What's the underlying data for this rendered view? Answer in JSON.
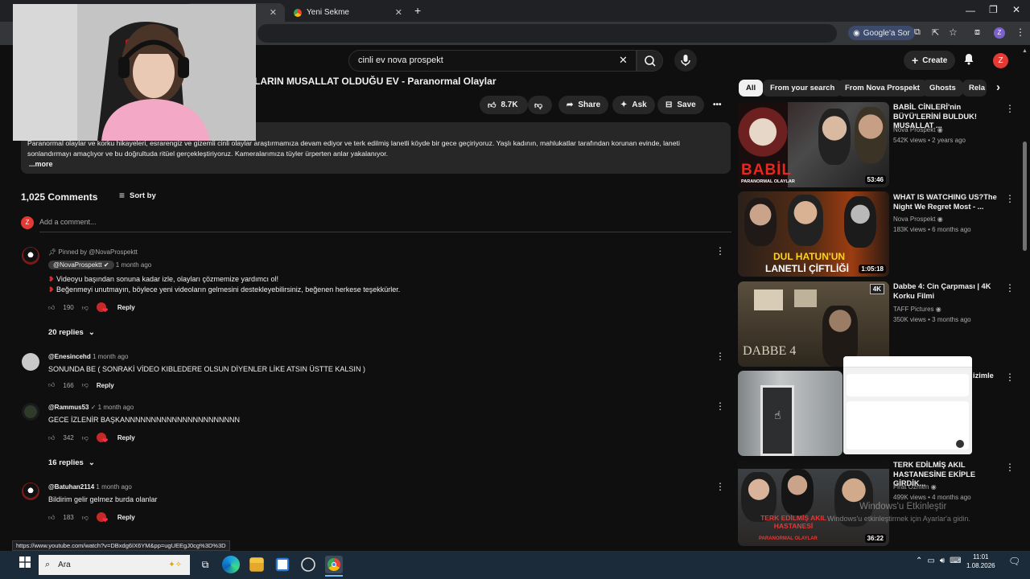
{
  "browser": {
    "tabs": [
      {
        "title": ""
      },
      {
        "title": "Yeni Sekme"
      }
    ],
    "new_tab": "+",
    "google_sor": "Google'a Sor",
    "profile_initial": "Z",
    "status_url": "https://www.youtube.com/watch?v=DBxdg6IX6YM&pp=ugUEEgJ0cg%3D%3D"
  },
  "youtube": {
    "search_value": "cinli ev nova prospekt",
    "create_label": "Create",
    "avatar_initial": "Z",
    "video_title": "LARIN MUSALLAT OLDUĞU EV - Paranormal Olaylar",
    "actions": {
      "likes": "8.7K",
      "share": "Share",
      "ask": "Ask",
      "save": "Save"
    },
    "description_line1": "Paranormal olaylar ve korku hikayeleri, esrarengiz ve gizemli cinli olaylar araştırmamıza devam ediyor ve terk edilmiş lanetli köyde bir gece geçiriyoruz. Yaşlı kadının, mahlukatlar tarafından korunan evinde, laneti",
    "description_line2": "sonlandırmayı amaçlıyor ve bu doğrultuda ritüel gerçekleştiriyoruz. Kameralarımıza tüyler ürperten anlar yakalanıyor.",
    "description_more": "...more",
    "comment_count": "1,025 Comments",
    "sort_by": "Sort by",
    "add_comment": "Add a comment...",
    "self_initial": "Z",
    "comments": [
      {
        "pinned": "Pinned by @NovaProspektt",
        "author": "@NovaProspektt",
        "time": "1 month ago",
        "line1": "Videoyu başından sonuna kadar izle, olayları çözmemize yardımcı ol!",
        "line2": "Beğenmeyi unutmayın, böylece yeni videoların gelmesini destekleyebilirsiniz, beğenen herkese teşekkürler.",
        "likes": "190",
        "reply": "Reply",
        "replies": "20 replies"
      },
      {
        "author": "@Enesincehd",
        "time": "1 month ago",
        "line1": "SONUNDA BE ( SONRAKİ VİDEO KIBLEDERE OLSUN DİYENLER LİKE ATSIN ÜSTTE KALSIN )",
        "likes": "166",
        "reply": "Reply"
      },
      {
        "author": "@Rammus53",
        "time": "1 month ago",
        "line1": "GECE İZLENİR BAŞKANNNNNNNNNNNNNNNNNNNNNN",
        "likes": "342",
        "reply": "Reply",
        "replies": "16 replies"
      },
      {
        "author": "@Batuhan2114",
        "time": "1 month ago",
        "line1": "Bildirim gelir gelmez burda olanlar",
        "likes": "183",
        "reply": "Reply"
      }
    ],
    "chips": [
      "All",
      "From your search",
      "From Nova Prospekt",
      "Ghosts",
      "Rela"
    ],
    "recommendations": [
      {
        "title": "BABİL CİNLERİ'nin BÜYÜ'LERİNİ BULDUK! MUSALLAT ...",
        "channel": "Nova Prospekt",
        "meta": "542K views • 2 years ago",
        "duration": "53:46",
        "thumb_text": "BABİL",
        "thumb_sub": "PARANORMAL OLAYLAR",
        "color": "#3a2a2a"
      },
      {
        "title": "WHAT IS WATCHING US?The Night We Regret Most - ...",
        "channel": "Nova Prospekt",
        "meta": "183K views • 6 months ago",
        "duration": "1:05:18",
        "thumb_text": "DUL HATUN'UN",
        "thumb_sub": "LANETLİ ÇİFTLİĞİ",
        "color": "#2b1e16"
      },
      {
        "title": "Dabbe 4: Cin Çarpması | 4K Korku Filmi",
        "channel": "TAFF Pictures",
        "meta": "350K views • 3 months ago",
        "duration": "",
        "thumb_text": "DABBE 4",
        "thumb_sub": "",
        "badge": "4K",
        "color": "#3d3528"
      },
      {
        "title": "izimle",
        "channel": "",
        "meta": "",
        "duration": "",
        "thumb_text": "",
        "thumb_sub": "",
        "color": "#9fa3a6"
      },
      {
        "title": "TERK EDİLMİŞ AKIL HASTANESİNE EKİPLE GİRDİK...",
        "channel": "Fırat Özmen",
        "meta": "499K views • 4 months ago",
        "duration": "36:22",
        "thumb_text": "TERK EDİLMİŞ AKIL HASTANESİ",
        "thumb_sub": "PARANORMAL OLAYLAR",
        "color": "#3b3b3b"
      }
    ]
  },
  "windows": {
    "activate_line1": "Windows'u Etkinleştir",
    "activate_line2": "Windows'u etkinleştirmek için Ayarlar'a gidin.",
    "search_placeholder": "Ara",
    "time": "11:01",
    "date": "1.08.2026"
  }
}
